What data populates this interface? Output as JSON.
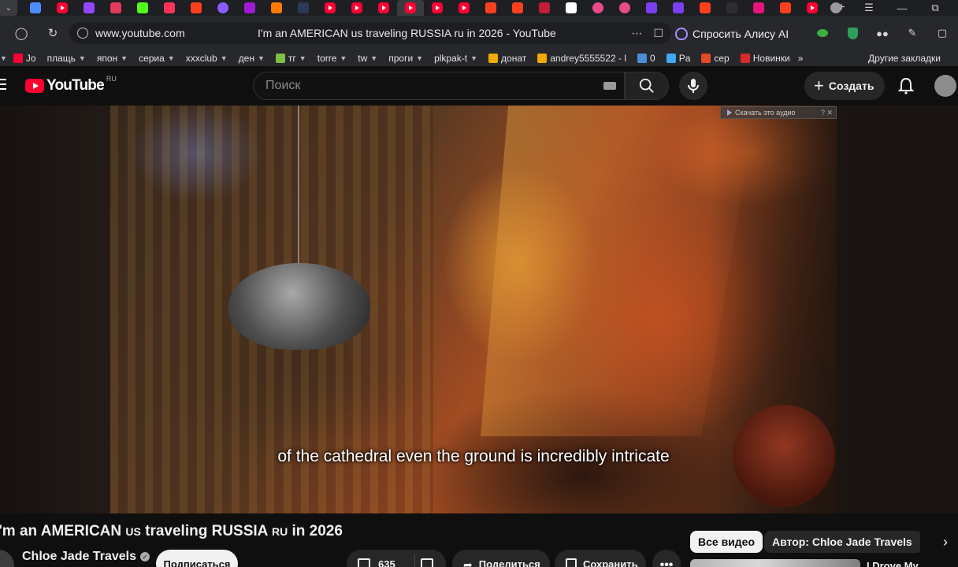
{
  "browser": {
    "tabs": [
      {
        "icon": "mail-icon",
        "color": "#4c8dff"
      },
      {
        "icon": "youtube-icon",
        "color": "#ff0033"
      },
      {
        "icon": "twitch-icon",
        "color": "#9146ff"
      },
      {
        "icon": "bookmark-icon",
        "color": "#e23a5a"
      },
      {
        "icon": "kick-icon",
        "color": "#53fc18"
      },
      {
        "icon": "live-icon",
        "color": "#ff3355"
      },
      {
        "icon": "yandex-icon",
        "color": "#fc3f1d"
      },
      {
        "icon": "circle-icon",
        "color": "#8a5cff"
      },
      {
        "icon": "wildberries-icon",
        "color": "#a21bd4"
      },
      {
        "icon": "flame-icon",
        "color": "#ff7a00"
      },
      {
        "icon": "game-icon",
        "color": "#2b3a55"
      },
      {
        "icon": "youtube-icon",
        "color": "#ff0033"
      },
      {
        "icon": "youtube-icon",
        "color": "#ff0033"
      },
      {
        "icon": "youtube-icon",
        "color": "#ff0033"
      },
      {
        "icon": "youtube-icon",
        "color": "#ff0033",
        "active": true
      },
      {
        "icon": "youtube-icon",
        "color": "#ff0033"
      },
      {
        "icon": "youtube-icon",
        "color": "#ff0033"
      },
      {
        "icon": "yandex-icon",
        "color": "#fc3f1d"
      },
      {
        "icon": "yandex-icon",
        "color": "#fc3f1d"
      },
      {
        "icon": "dots-icon",
        "color": "#c21d3a"
      },
      {
        "icon": "wiki-icon",
        "color": "#ffffff"
      },
      {
        "icon": "play-icon",
        "color": "#e94b8a"
      },
      {
        "icon": "play-icon",
        "color": "#e94b8a"
      },
      {
        "icon": "b-icon",
        "color": "#7b3ff2"
      },
      {
        "icon": "b-icon",
        "color": "#7b3ff2"
      },
      {
        "icon": "yandex-icon",
        "color": "#fc3f1d"
      },
      {
        "icon": "r-icon",
        "color": "#2d2d2d"
      },
      {
        "icon": "x-icon",
        "color": "#e6157a"
      },
      {
        "icon": "yandex-icon",
        "color": "#fc3f1d"
      },
      {
        "icon": "youtube-icon",
        "color": "#ff0033"
      }
    ],
    "url": "www.youtube.com",
    "page_title": "I'm an AMERICAN us traveling RUSSIA ru in 2026 - YouTube",
    "alice_label": "Спросить Алису AI",
    "bookmarks": [
      {
        "label": "Jo",
        "icon": "youtube-icon",
        "color": "#ff0033",
        "chevron": false
      },
      {
        "label": "плащь",
        "chevron": true
      },
      {
        "label": "япон",
        "chevron": true
      },
      {
        "label": "сериа",
        "chevron": true
      },
      {
        "label": "xxxclub",
        "chevron": true
      },
      {
        "label": "ден",
        "chevron": true
      },
      {
        "label": "тг",
        "icon": "plant-icon",
        "color": "#7bc043",
        "chevron": true
      },
      {
        "label": "torre",
        "chevron": true
      },
      {
        "label": "tw",
        "chevron": true
      },
      {
        "label": "проги",
        "chevron": true
      },
      {
        "label": "plkpak-t",
        "chevron": true
      },
      {
        "label": "донат",
        "icon": "d-icon",
        "color": "#f2a900",
        "chevron": false
      },
      {
        "label": "andrey5555522 - l",
        "icon": "d-icon",
        "color": "#f2a900",
        "chevron": false
      },
      {
        "label": "0",
        "icon": "counter-icon",
        "color": "#4a90d9",
        "chevron": false
      },
      {
        "label": "Pa",
        "icon": "globe-icon",
        "color": "#3fa9f5",
        "chevron": false
      },
      {
        "label": "сер",
        "icon": "leaf-icon",
        "color": "#e24b26",
        "chevron": false
      },
      {
        "label": "Новинки",
        "icon": "lf-icon",
        "color": "#d72a2a",
        "chevron": false
      }
    ],
    "other_bookmarks": "Другие закладки",
    "more_chevron": "»"
  },
  "youtube": {
    "logo_text": "YouTube",
    "region": "RU",
    "search_placeholder": "Поиск",
    "create_label": "Создать",
    "subtitle": "of the cathedral even the ground is incredibly intricate",
    "download_badge": "Скачать это аудио",
    "video_title_parts": [
      "I'm an AMERICAN ",
      "US",
      " traveling RUSSIA ",
      "RU",
      " in 2026"
    ],
    "channel_name": "Chloe Jade Travels",
    "subscribe_label": "Подписаться",
    "like_count": "635",
    "share_label": "Поделиться",
    "save_label": "Сохранить",
    "more_label": "•••",
    "chips": [
      "Все видео",
      "Автор: Chloe Jade Travels"
    ],
    "next_video_title": "I Drove My"
  }
}
